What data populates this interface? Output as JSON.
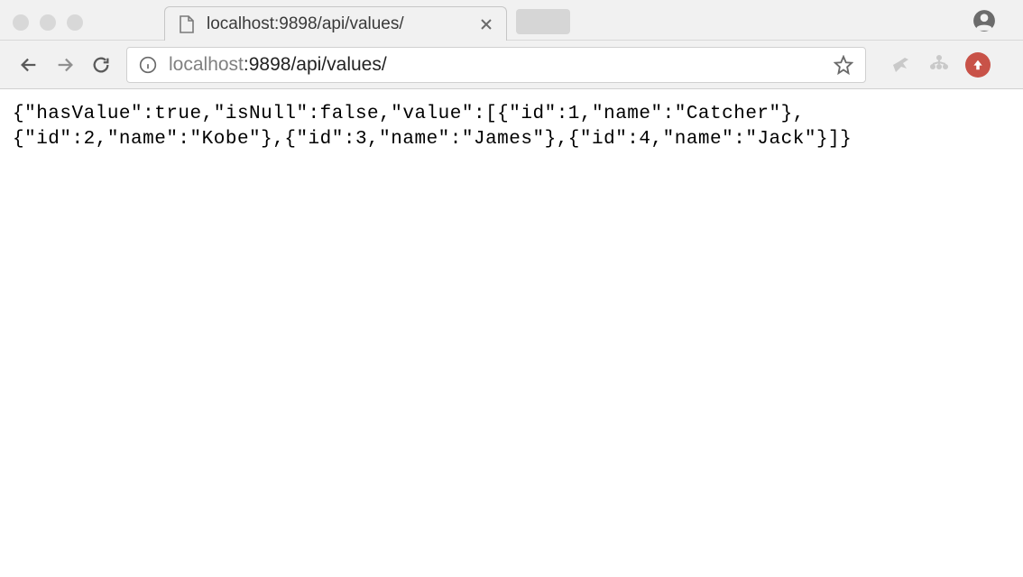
{
  "tab": {
    "title": "localhost:9898/api/values/"
  },
  "url": {
    "host": "localhost",
    "rest": ":9898/api/values/"
  },
  "response": {
    "hasValue": true,
    "isNull": false,
    "value": [
      {
        "id": 1,
        "name": "Catcher"
      },
      {
        "id": 2,
        "name": "Kobe"
      },
      {
        "id": 3,
        "name": "James"
      },
      {
        "id": 4,
        "name": "Jack"
      }
    ]
  }
}
